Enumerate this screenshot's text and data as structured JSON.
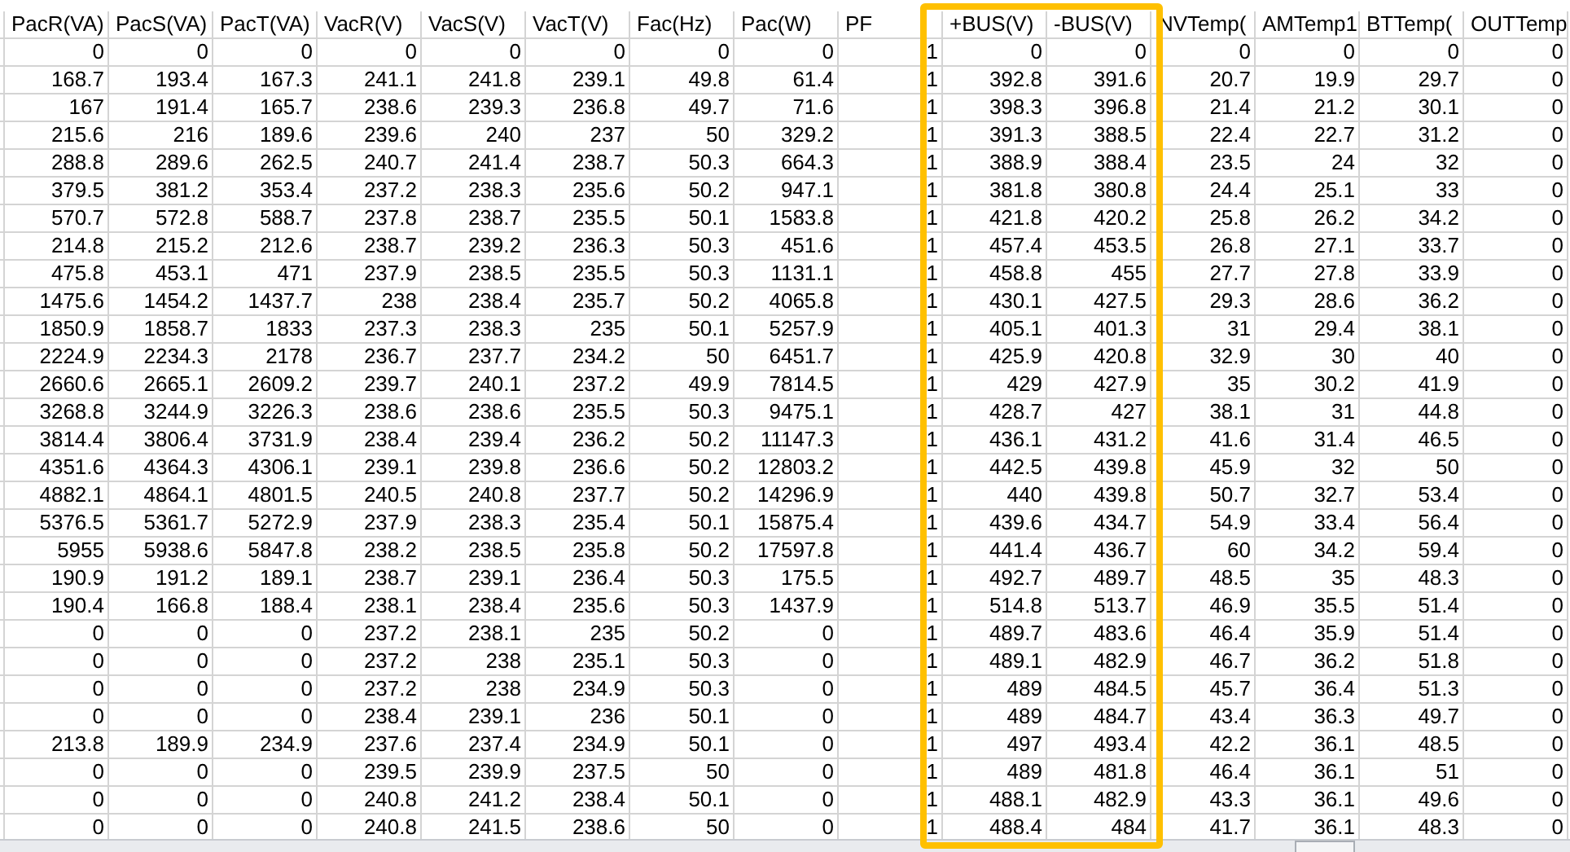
{
  "columns": [
    "PacR(VA)",
    "PacS(VA)",
    "PacT(VA)",
    "VacR(V)",
    "VacS(V)",
    "VacT(V)",
    "Fac(Hz)",
    "Pac(W)",
    "PF",
    "+BUS(V)",
    "-BUS(V)",
    "NVTemp(",
    "AMTemp1",
    "BTTemp(",
    "OUTTemp"
  ],
  "rows": [
    [
      "0",
      "0",
      "0",
      "0",
      "0",
      "0",
      "0",
      "0",
      "1",
      "0",
      "0",
      "0",
      "0",
      "0",
      "0"
    ],
    [
      "168.7",
      "193.4",
      "167.3",
      "241.1",
      "241.8",
      "239.1",
      "49.8",
      "61.4",
      "1",
      "392.8",
      "391.6",
      "20.7",
      "19.9",
      "29.7",
      "0"
    ],
    [
      "167",
      "191.4",
      "165.7",
      "238.6",
      "239.3",
      "236.8",
      "49.7",
      "71.6",
      "1",
      "398.3",
      "396.8",
      "21.4",
      "21.2",
      "30.1",
      "0"
    ],
    [
      "215.6",
      "216",
      "189.6",
      "239.6",
      "240",
      "237",
      "50",
      "329.2",
      "1",
      "391.3",
      "388.5",
      "22.4",
      "22.7",
      "31.2",
      "0"
    ],
    [
      "288.8",
      "289.6",
      "262.5",
      "240.7",
      "241.4",
      "238.7",
      "50.3",
      "664.3",
      "1",
      "388.9",
      "388.4",
      "23.5",
      "24",
      "32",
      "0"
    ],
    [
      "379.5",
      "381.2",
      "353.4",
      "237.2",
      "238.3",
      "235.6",
      "50.2",
      "947.1",
      "1",
      "381.8",
      "380.8",
      "24.4",
      "25.1",
      "33",
      "0"
    ],
    [
      "570.7",
      "572.8",
      "588.7",
      "237.8",
      "238.7",
      "235.5",
      "50.1",
      "1583.8",
      "1",
      "421.8",
      "420.2",
      "25.8",
      "26.2",
      "34.2",
      "0"
    ],
    [
      "214.8",
      "215.2",
      "212.6",
      "238.7",
      "239.2",
      "236.3",
      "50.3",
      "451.6",
      "1",
      "457.4",
      "453.5",
      "26.8",
      "27.1",
      "33.7",
      "0"
    ],
    [
      "475.8",
      "453.1",
      "471",
      "237.9",
      "238.5",
      "235.5",
      "50.3",
      "1131.1",
      "1",
      "458.8",
      "455",
      "27.7",
      "27.8",
      "33.9",
      "0"
    ],
    [
      "1475.6",
      "1454.2",
      "1437.7",
      "238",
      "238.4",
      "235.7",
      "50.2",
      "4065.8",
      "1",
      "430.1",
      "427.5",
      "29.3",
      "28.6",
      "36.2",
      "0"
    ],
    [
      "1850.9",
      "1858.7",
      "1833",
      "237.3",
      "238.3",
      "235",
      "50.1",
      "5257.9",
      "1",
      "405.1",
      "401.3",
      "31",
      "29.4",
      "38.1",
      "0"
    ],
    [
      "2224.9",
      "2234.3",
      "2178",
      "236.7",
      "237.7",
      "234.2",
      "50",
      "6451.7",
      "1",
      "425.9",
      "420.8",
      "32.9",
      "30",
      "40",
      "0"
    ],
    [
      "2660.6",
      "2665.1",
      "2609.2",
      "239.7",
      "240.1",
      "237.2",
      "49.9",
      "7814.5",
      "1",
      "429",
      "427.9",
      "35",
      "30.2",
      "41.9",
      "0"
    ],
    [
      "3268.8",
      "3244.9",
      "3226.3",
      "238.6",
      "238.6",
      "235.5",
      "50.3",
      "9475.1",
      "1",
      "428.7",
      "427",
      "38.1",
      "31",
      "44.8",
      "0"
    ],
    [
      "3814.4",
      "3806.4",
      "3731.9",
      "238.4",
      "239.4",
      "236.2",
      "50.2",
      "11147.3",
      "1",
      "436.1",
      "431.2",
      "41.6",
      "31.4",
      "46.5",
      "0"
    ],
    [
      "4351.6",
      "4364.3",
      "4306.1",
      "239.1",
      "239.8",
      "236.6",
      "50.2",
      "12803.2",
      "1",
      "442.5",
      "439.8",
      "45.9",
      "32",
      "50",
      "0"
    ],
    [
      "4882.1",
      "4864.1",
      "4801.5",
      "240.5",
      "240.8",
      "237.7",
      "50.2",
      "14296.9",
      "1",
      "440",
      "439.8",
      "50.7",
      "32.7",
      "53.4",
      "0"
    ],
    [
      "5376.5",
      "5361.7",
      "5272.9",
      "237.9",
      "238.3",
      "235.4",
      "50.1",
      "15875.4",
      "1",
      "439.6",
      "434.7",
      "54.9",
      "33.4",
      "56.4",
      "0"
    ],
    [
      "5955",
      "5938.6",
      "5847.8",
      "238.2",
      "238.5",
      "235.8",
      "50.2",
      "17597.8",
      "1",
      "441.4",
      "436.7",
      "60",
      "34.2",
      "59.4",
      "0"
    ],
    [
      "190.9",
      "191.2",
      "189.1",
      "238.7",
      "239.1",
      "236.4",
      "50.3",
      "175.5",
      "1",
      "492.7",
      "489.7",
      "48.5",
      "35",
      "48.3",
      "0"
    ],
    [
      "190.4",
      "166.8",
      "188.4",
      "238.1",
      "238.4",
      "235.6",
      "50.3",
      "1437.9",
      "1",
      "514.8",
      "513.7",
      "46.9",
      "35.5",
      "51.4",
      "0"
    ],
    [
      "0",
      "0",
      "0",
      "237.2",
      "238.1",
      "235",
      "50.2",
      "0",
      "1",
      "489.7",
      "483.6",
      "46.4",
      "35.9",
      "51.4",
      "0"
    ],
    [
      "0",
      "0",
      "0",
      "237.2",
      "238",
      "235.1",
      "50.3",
      "0",
      "1",
      "489.1",
      "482.9",
      "46.7",
      "36.2",
      "51.8",
      "0"
    ],
    [
      "0",
      "0",
      "0",
      "237.2",
      "238",
      "234.9",
      "50.3",
      "0",
      "1",
      "489",
      "484.5",
      "45.7",
      "36.4",
      "51.3",
      "0"
    ],
    [
      "0",
      "0",
      "0",
      "238.4",
      "239.1",
      "236",
      "50.1",
      "0",
      "1",
      "489",
      "484.7",
      "43.4",
      "36.3",
      "49.7",
      "0"
    ],
    [
      "213.8",
      "189.9",
      "234.9",
      "237.6",
      "237.4",
      "234.9",
      "50.1",
      "0",
      "1",
      "497",
      "493.4",
      "42.2",
      "36.1",
      "48.5",
      "0"
    ],
    [
      "0",
      "0",
      "0",
      "239.5",
      "239.9",
      "237.5",
      "50",
      "0",
      "1",
      "489",
      "481.8",
      "46.4",
      "36.1",
      "51",
      "0"
    ],
    [
      "0",
      "0",
      "0",
      "240.8",
      "241.2",
      "238.4",
      "50.1",
      "0",
      "1",
      "488.1",
      "482.9",
      "43.3",
      "36.1",
      "49.6",
      "0"
    ],
    [
      "0",
      "0",
      "0",
      "240.8",
      "241.5",
      "238.6",
      "50",
      "0",
      "1",
      "488.4",
      "484",
      "41.7",
      "36.1",
      "48.3",
      "0"
    ]
  ]
}
